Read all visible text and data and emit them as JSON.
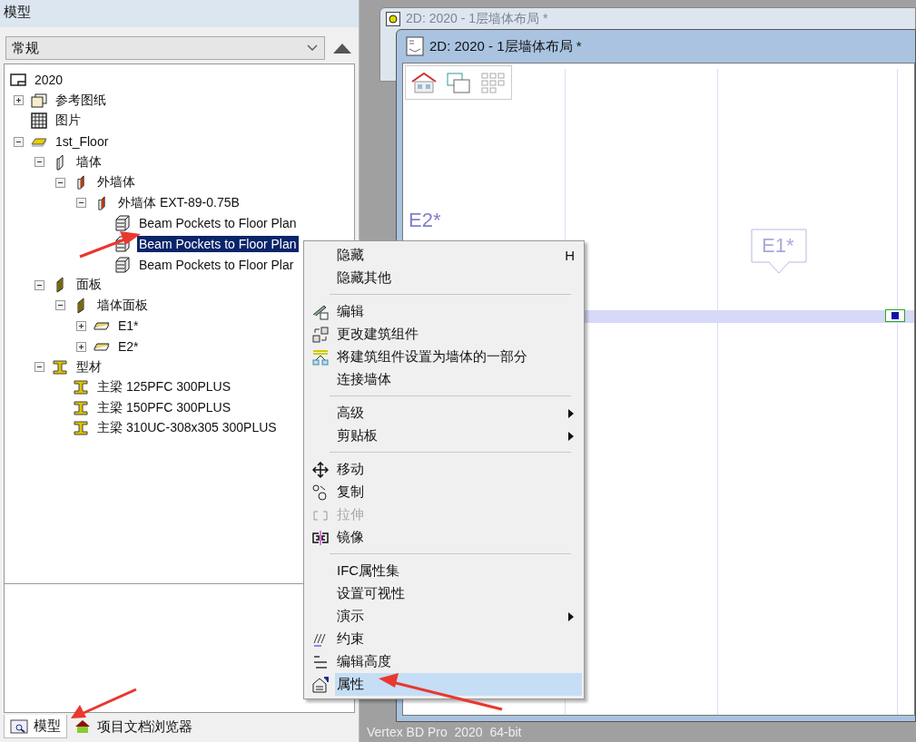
{
  "panel": {
    "title": "模型",
    "filter": "常规"
  },
  "tree": [
    {
      "label": "2020",
      "kind": "level",
      "selected": false,
      "children": [
        {
          "label": "参考图纸",
          "kind": "reference",
          "expanded": false,
          "selected": false
        },
        {
          "label": "图片",
          "kind": "image",
          "selected": false
        },
        {
          "label": "1st_Floor",
          "kind": "floor",
          "expanded": true,
          "selected": false,
          "children": [
            {
              "label": "墙体",
              "kind": "wall",
              "expanded": true,
              "selected": false,
              "children": [
                {
                  "label": "外墙体",
                  "kind": "ext-wall",
                  "expanded": true,
                  "selected": false,
                  "children": [
                    {
                      "label": "外墙体 EXT-89-0.75B",
                      "kind": "ext-wall",
                      "expanded": true,
                      "selected": false,
                      "children": [
                        {
                          "label": "Beam Pockets to Floor Plan",
                          "kind": "element",
                          "selected": false
                        },
                        {
                          "label": "Beam Pockets to Floor Plan",
                          "kind": "element",
                          "selected": true
                        },
                        {
                          "label": "Beam Pockets to Floor Plar",
                          "kind": "element",
                          "selected": false
                        }
                      ]
                    }
                  ]
                }
              ]
            },
            {
              "label": "面板",
              "kind": "panel",
              "expanded": true,
              "selected": false,
              "children": [
                {
                  "label": "墙体面板",
                  "kind": "panel",
                  "expanded": true,
                  "selected": false,
                  "children": [
                    {
                      "label": "E1*",
                      "kind": "panel-item",
                      "expanded": false,
                      "selected": false
                    },
                    {
                      "label": "E2*",
                      "kind": "panel-item",
                      "expanded": false,
                      "selected": false
                    }
                  ]
                }
              ]
            },
            {
              "label": "型材",
              "kind": "framing",
              "expanded": true,
              "selected": false,
              "children": [
                {
                  "label": "主梁 125PFC 300PLUS",
                  "kind": "framing",
                  "selected": false
                },
                {
                  "label": "主梁 150PFC 300PLUS",
                  "kind": "framing",
                  "selected": false
                },
                {
                  "label": "主梁 310UC-308x305 300PLUS",
                  "kind": "framing",
                  "selected": false
                }
              ]
            }
          ]
        }
      ]
    }
  ],
  "bottom_tabs": [
    {
      "label": "模型",
      "selected": true
    },
    {
      "label": "项目文档浏览器",
      "selected": false
    }
  ],
  "back_window": {
    "title": "2D: 2020 - 1层墙体布局 *"
  },
  "front_window": {
    "title": "2D: 2020 - 1层墙体布局 *"
  },
  "canvas": {
    "labels": [
      "E2*",
      "E1*"
    ]
  },
  "context_menu": [
    {
      "kind": "item",
      "label": "隐藏",
      "shortcut": "H",
      "disabled": false,
      "submenu": false,
      "selected": false
    },
    {
      "kind": "item",
      "label": "隐藏其他",
      "disabled": false,
      "submenu": false,
      "selected": false
    },
    {
      "kind": "separator"
    },
    {
      "kind": "item",
      "label": "编辑",
      "disabled": false,
      "submenu": false,
      "selected": false
    },
    {
      "kind": "item",
      "label": "更改建筑组件",
      "disabled": false,
      "submenu": false,
      "selected": false
    },
    {
      "kind": "item",
      "label": "将建筑组件设置为墙体的一部分",
      "disabled": false,
      "submenu": false,
      "selected": false
    },
    {
      "kind": "item",
      "label": "连接墙体",
      "disabled": false,
      "submenu": false,
      "selected": false
    },
    {
      "kind": "separator"
    },
    {
      "kind": "item",
      "label": "高级",
      "disabled": false,
      "submenu": true,
      "selected": false
    },
    {
      "kind": "item",
      "label": "剪贴板",
      "disabled": false,
      "submenu": true,
      "selected": false
    },
    {
      "kind": "separator"
    },
    {
      "kind": "item",
      "label": "移动",
      "disabled": false,
      "submenu": false,
      "selected": false
    },
    {
      "kind": "item",
      "label": "复制",
      "disabled": false,
      "submenu": false,
      "selected": false
    },
    {
      "kind": "item",
      "label": "拉伸",
      "disabled": true,
      "submenu": false,
      "selected": false
    },
    {
      "kind": "item",
      "label": "镜像",
      "disabled": false,
      "submenu": false,
      "selected": false
    },
    {
      "kind": "separator"
    },
    {
      "kind": "item",
      "label": "IFC属性集",
      "disabled": false,
      "submenu": false,
      "selected": false
    },
    {
      "kind": "item",
      "label": "设置可视性",
      "disabled": false,
      "submenu": false,
      "selected": false
    },
    {
      "kind": "item",
      "label": "演示",
      "disabled": false,
      "submenu": true,
      "selected": false
    },
    {
      "kind": "item",
      "label": "约束",
      "disabled": false,
      "submenu": false,
      "selected": false
    },
    {
      "kind": "item",
      "label": "编辑高度",
      "disabled": false,
      "submenu": false,
      "selected": false
    },
    {
      "kind": "item",
      "label": "属性",
      "disabled": false,
      "submenu": false,
      "selected": true
    }
  ],
  "status_bar": {
    "text": "Vertex BD Pro  2020  64-bit"
  }
}
